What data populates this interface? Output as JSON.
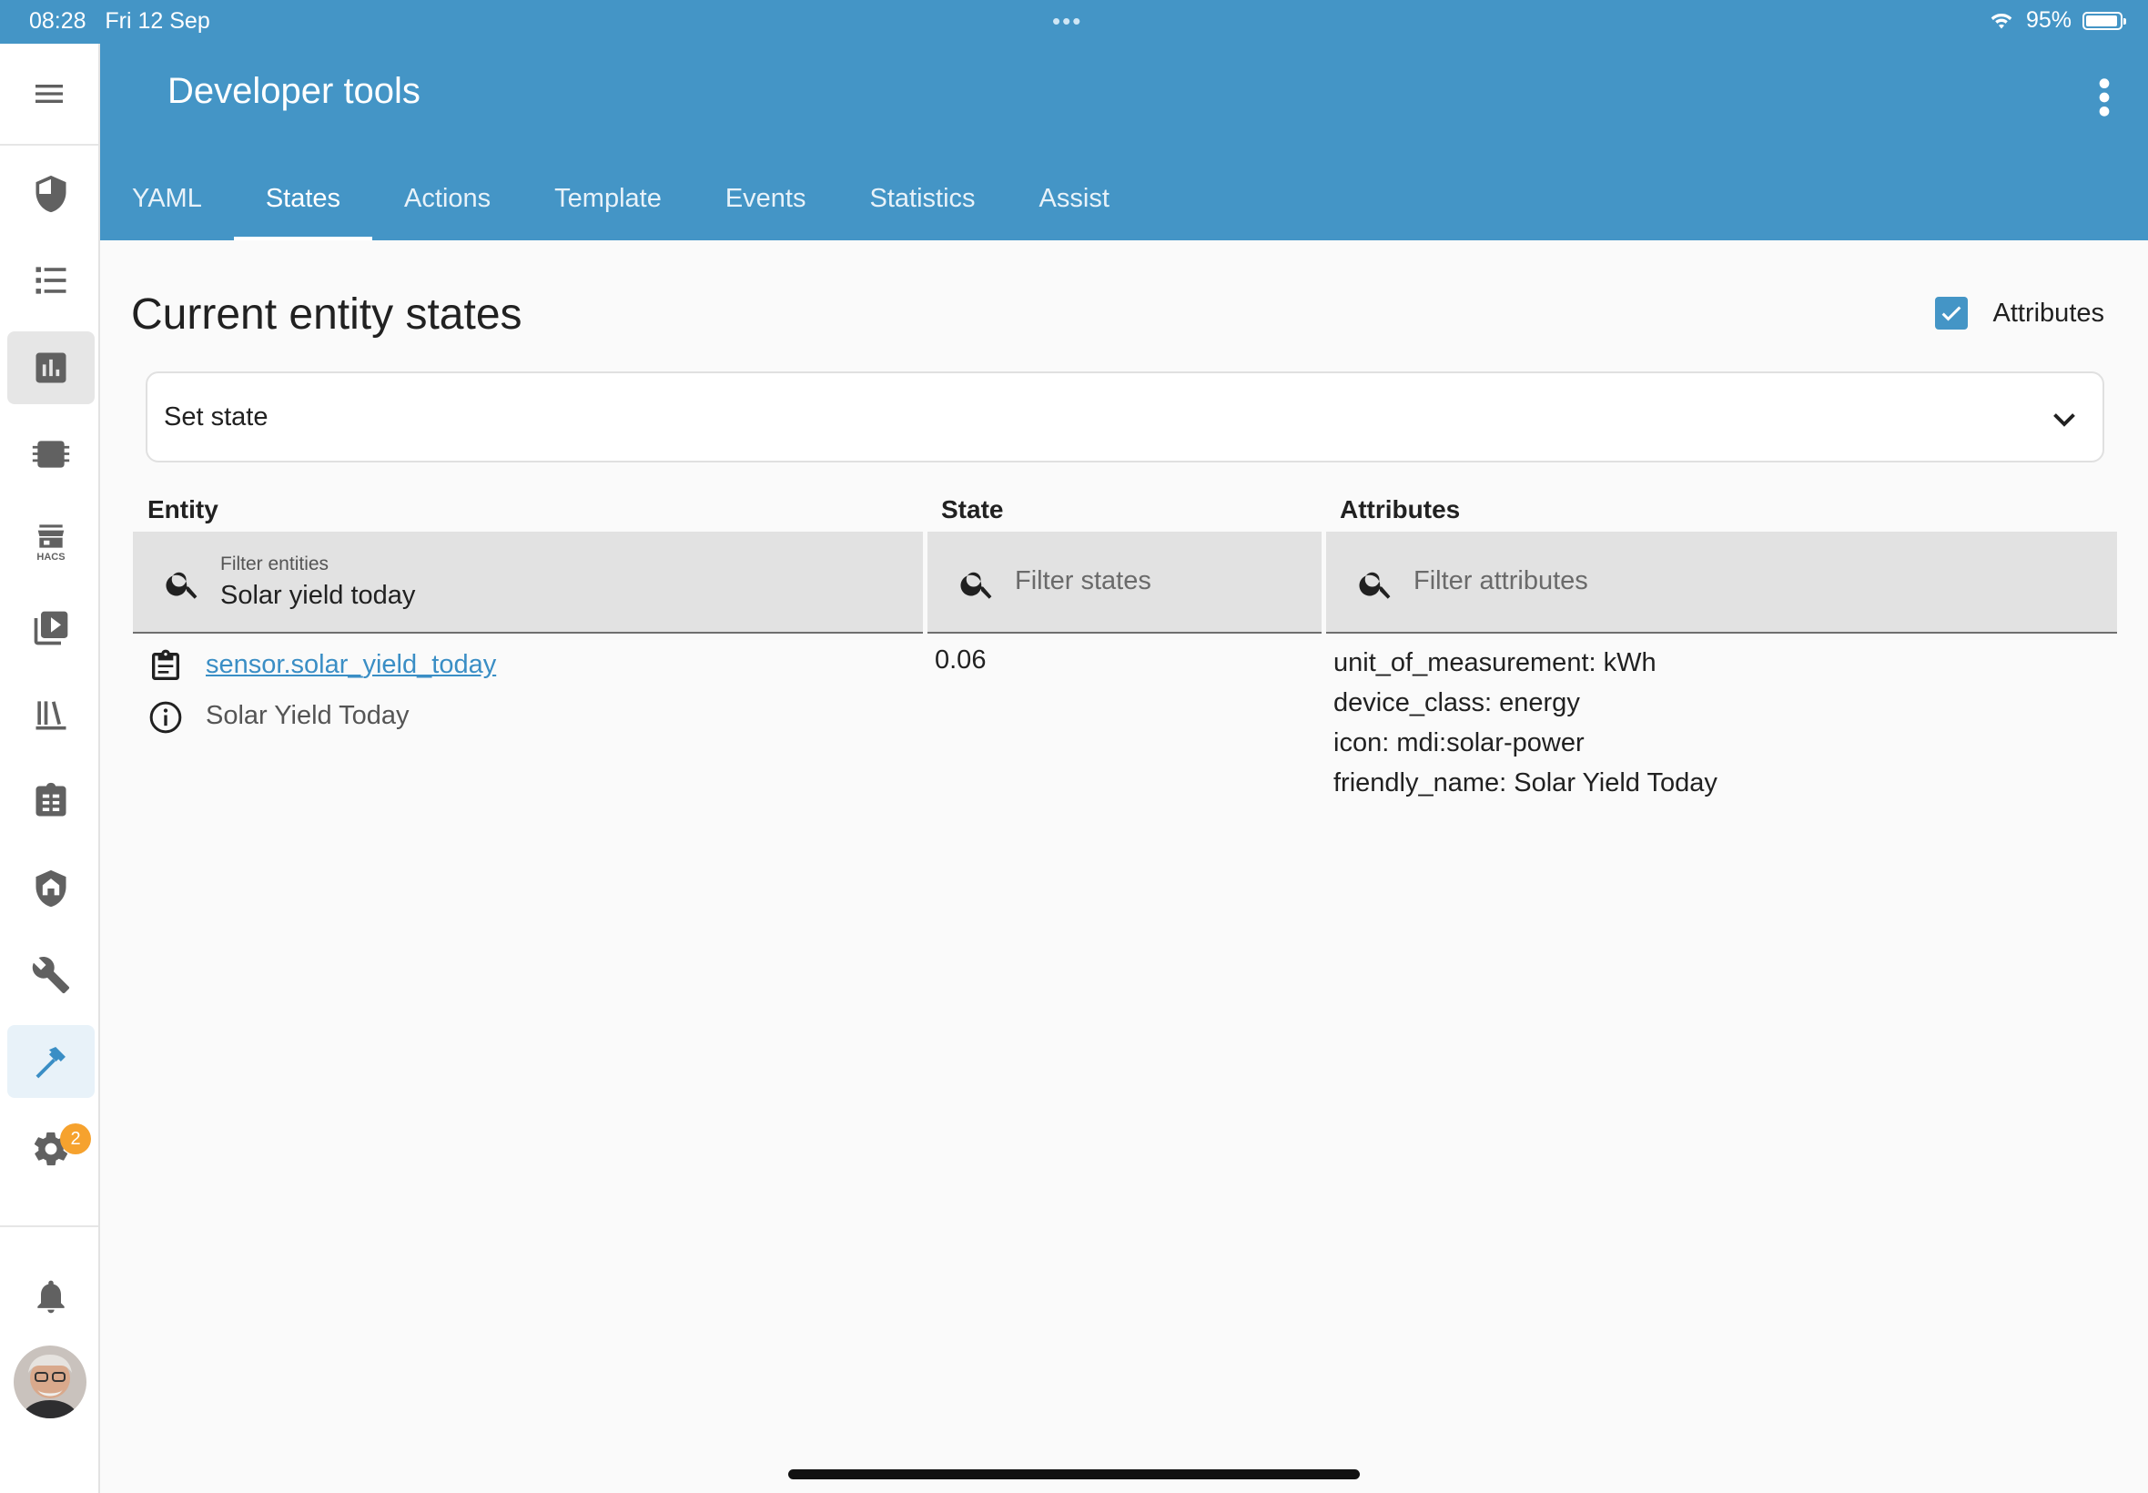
{
  "status_bar": {
    "time": "08:28",
    "date": "Fri 12 Sep",
    "dots": "•••",
    "battery": "95%"
  },
  "header": {
    "title": "Developer tools"
  },
  "tabs": [
    {
      "label": "YAML"
    },
    {
      "label": "States"
    },
    {
      "label": "Actions"
    },
    {
      "label": "Template"
    },
    {
      "label": "Events"
    },
    {
      "label": "Statistics"
    },
    {
      "label": "Assist"
    }
  ],
  "sidebar": {
    "items": [
      {
        "icon": "shield-half-icon"
      },
      {
        "icon": "list-icon"
      },
      {
        "icon": "chart-box-icon"
      },
      {
        "icon": "chip-icon"
      },
      {
        "icon": "hacs-store-icon",
        "caption": "HACS"
      },
      {
        "icon": "media-play-icon"
      },
      {
        "icon": "library-icon"
      },
      {
        "icon": "clipboard-list-icon"
      },
      {
        "icon": "shield-home-icon"
      },
      {
        "icon": "wrench-icon"
      },
      {
        "icon": "hammer-icon"
      },
      {
        "icon": "gear-icon",
        "badge": "2"
      }
    ],
    "notifications_icon": "bell-icon"
  },
  "main": {
    "page_title": "Current entity states",
    "attributes_toggle_label": "Attributes",
    "set_state_label": "Set state",
    "columns": {
      "entity": "Entity",
      "state": "State",
      "attributes": "Attributes"
    },
    "filters": {
      "entity_label": "Filter entities",
      "entity_value": "Solar yield today",
      "state_placeholder": "Filter states",
      "attributes_placeholder": "Filter attributes"
    },
    "row": {
      "entity_id": "sensor.solar_yield_today",
      "friendly_name": "Solar Yield Today",
      "state": "0.06",
      "attributes": [
        "unit_of_measurement: kWh",
        "device_class: energy",
        "icon: mdi:solar-power",
        "friendly_name: Solar Yield Today"
      ]
    }
  },
  "colors": {
    "header_bg": "#4495c6",
    "accent": "#4495c6",
    "badge": "#f6a22e"
  }
}
